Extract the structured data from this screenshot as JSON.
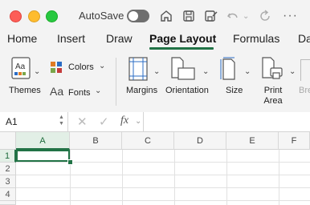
{
  "titlebar": {
    "autosave_label": "AutoSave",
    "autosave_on": false,
    "icons": [
      "home-icon",
      "save-icon",
      "save-as-icon",
      "undo-icon",
      "redo-icon"
    ]
  },
  "tabs": [
    {
      "label": "Home",
      "active": false
    },
    {
      "label": "Insert",
      "active": false
    },
    {
      "label": "Draw",
      "active": false
    },
    {
      "label": "Page Layout",
      "active": true
    },
    {
      "label": "Formulas",
      "active": false
    },
    {
      "label": "Da",
      "active": false
    }
  ],
  "ribbon": {
    "themes": "Themes",
    "colors": "Colors",
    "fonts": "Fonts",
    "fonts_glyph": "Aa",
    "margins": "Margins",
    "orientation": "Orientation",
    "size": "Size",
    "print_area_line1": "Print",
    "print_area_line2": "Area",
    "breaks_partial": "Bre"
  },
  "formula_bar": {
    "name_box": "A1",
    "fx_label": "fx",
    "formula": ""
  },
  "sheet": {
    "columns": [
      "A",
      "B",
      "C",
      "D",
      "E",
      "F"
    ],
    "rows": [
      "1",
      "2",
      "3",
      "4"
    ],
    "active_cell": "A1"
  },
  "colors": {
    "accent": "#217346"
  }
}
